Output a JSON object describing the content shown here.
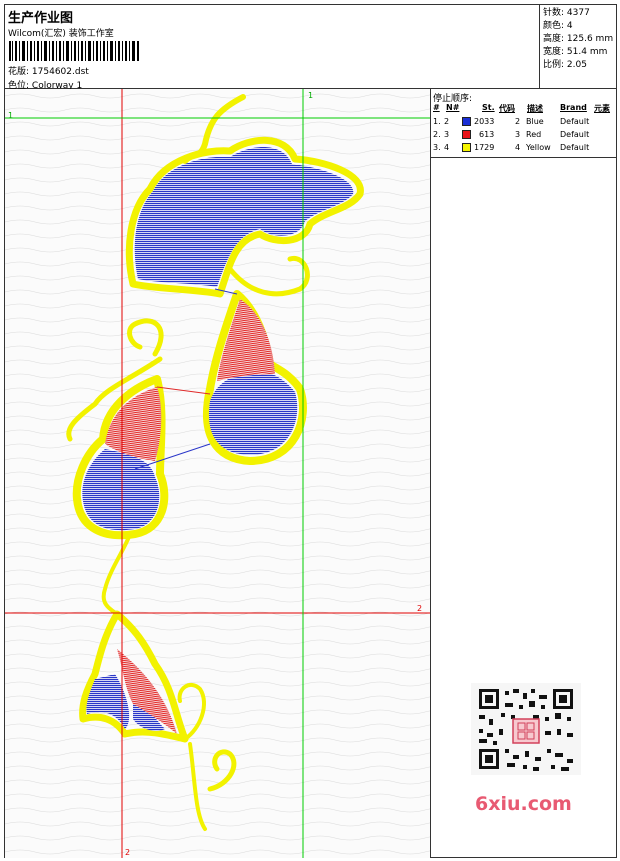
{
  "header": {
    "title": "生产作业图",
    "company": "Wilcom(汇宏) 装饰工作室",
    "design_label": "花版:",
    "design_value": "1754602.dst",
    "colorway_label": "色位:",
    "colorway_value": "Colorway 1"
  },
  "stats": {
    "stitches_label": "针数:",
    "stitches_value": "4377",
    "colors_label": "颜色:",
    "colors_value": "4",
    "height_label": "高度:",
    "height_value": "125.6 mm",
    "width_label": "宽度:",
    "width_value": "51.4 mm",
    "scale_label": "比例:",
    "scale_value": "2.05"
  },
  "stop_sequence": {
    "title": "停止顺序:",
    "columns": [
      "#",
      "N#",
      "St.",
      "代码",
      "描述",
      "Brand",
      "元素"
    ],
    "rows": [
      {
        "idx": "1.",
        "n": "2",
        "color": "#1a2fd6",
        "st": "2033",
        "code": "2",
        "desc": "Blue",
        "brand": "Default"
      },
      {
        "idx": "2.",
        "n": "3",
        "color": "#e8141a",
        "st": "613",
        "code": "3",
        "desc": "Red",
        "brand": "Default"
      },
      {
        "idx": "3.",
        "n": "4",
        "color": "#f5f500",
        "st": "1729",
        "code": "4",
        "desc": "Yellow",
        "brand": "Default"
      }
    ]
  },
  "guides": {
    "v1": "1",
    "h1": "1",
    "h2": "2",
    "v2": "2"
  },
  "watermark": "6xiu.com",
  "colors": {
    "blue": "#2a36c8",
    "red": "#e02a2a",
    "yellow": "#f2f200",
    "guide_red": "#e00000",
    "guide_green": "#00cc00"
  }
}
